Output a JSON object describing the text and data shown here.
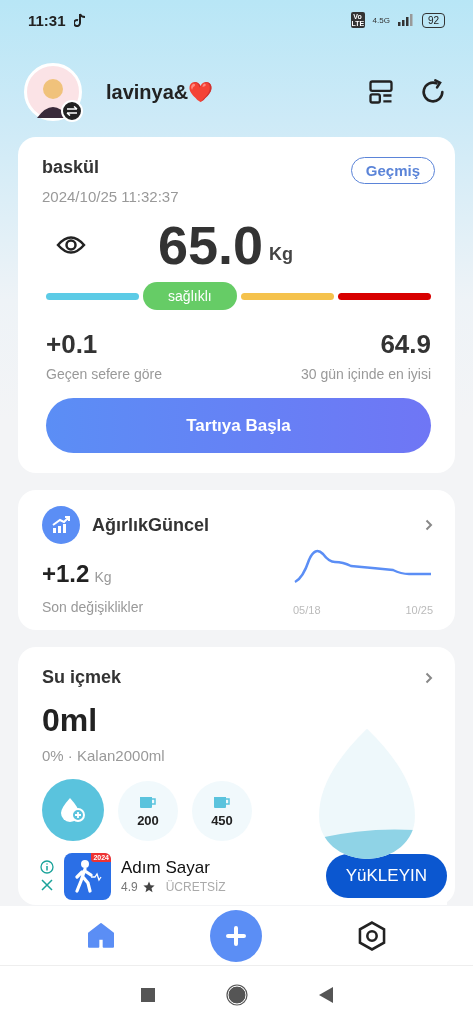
{
  "status_bar": {
    "time": "11:31",
    "network_badge": "Vo LTE",
    "network_type": "4.5G",
    "battery": "92"
  },
  "header": {
    "user_name": "lavinya&❤️"
  },
  "scale_card": {
    "title": "baskül",
    "timestamp": "2024/10/25 11:32:37",
    "history_button": "Geçmiş",
    "weight": "65.0",
    "unit": "Kg",
    "segments": [
      {
        "color": "#5ccbe6",
        "selected": false
      },
      {
        "label": "sağlıklı",
        "color": "#66cc66",
        "selected": true
      },
      {
        "color": "#f5c24c",
        "selected": false
      },
      {
        "color": "#d80000",
        "selected": false
      }
    ],
    "change_value": "+0.1",
    "change_label": "Geçen sefere göre",
    "best_value": "64.9",
    "best_label": "30 gün içinde en iyisi",
    "start_button": "Tartıya Başla"
  },
  "trend_card": {
    "title": "AğırlıkGüncel",
    "change_value": "+1.2",
    "unit": "Kg",
    "change_label": "Son değişiklikler",
    "date_start": "05/18",
    "date_end": "10/25"
  },
  "water_card": {
    "title": "Su içmek",
    "amount": "0ml",
    "summary": "0% · Kalan2000ml",
    "cups": [
      {
        "amount": "200"
      },
      {
        "amount": "450"
      }
    ]
  },
  "ad": {
    "app_badge": "2024",
    "app_name": "Adım Sayar",
    "rating": "4.9",
    "price": "ÜCRETSİZ",
    "install_button": "YüKLEYIN"
  },
  "bottom_nav": [
    {
      "kind": "home",
      "selected": true
    },
    {
      "kind": "add",
      "selected": false
    },
    {
      "kind": "settings",
      "selected": false
    }
  ]
}
